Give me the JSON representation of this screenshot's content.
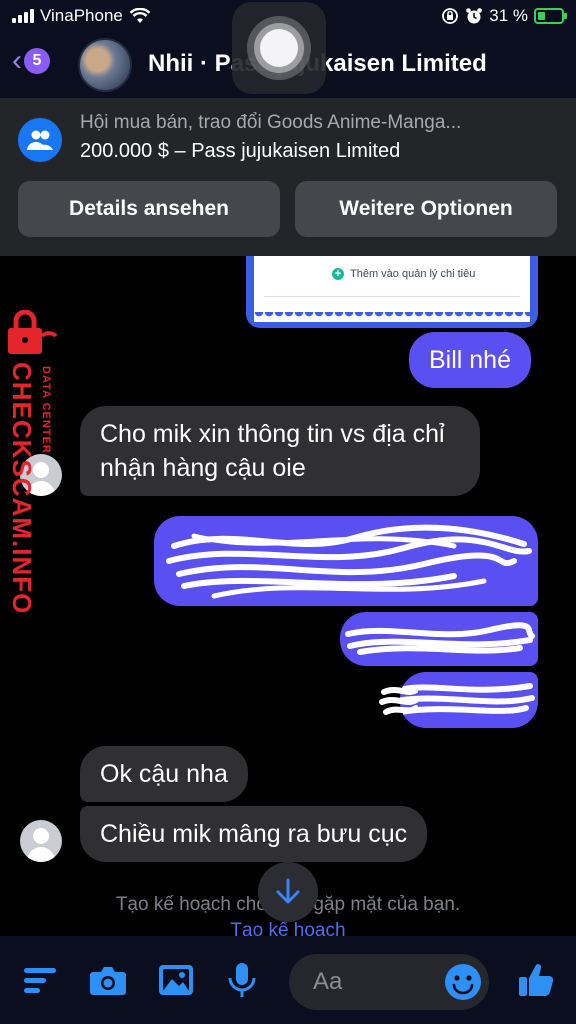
{
  "status_bar": {
    "carrier": "VinaPhone",
    "battery": "31 %",
    "battery_level": 0.31
  },
  "header": {
    "unread_count": "5",
    "title": "Nhii · Pass jujukaisen Limited"
  },
  "marketplace": {
    "group": "Hội mua bán, trao đổi Goods Anime-Manga...",
    "listing": "200.000 $ – Pass jujukaisen Limited",
    "details_button": "Details ansehen",
    "options_button": "Weitere Optionen"
  },
  "receipt": {
    "add_label": "Thêm vào quản lý chi tiêu"
  },
  "messages": [
    {
      "side": "out",
      "text": "Bill nhé"
    },
    {
      "side": "in",
      "text": "Cho mik xin thông tin vs địa chỉ nhận hàng cậu oie"
    },
    {
      "side": "in",
      "text": "Ok cậu nha"
    },
    {
      "side": "in",
      "text": "Chiều mik mâng ra bưu cục"
    }
  ],
  "watermark": {
    "brand": "CHECKSCAM.INFO",
    "sub": "DATA CENTER"
  },
  "plan": {
    "prompt": "Tạo kế hoạch cho buổi gặp mặt của bạn.",
    "link": "Tạo kế hoạch"
  },
  "composer": {
    "placeholder": "Aa"
  },
  "colors": {
    "accent": "#5a4ff1",
    "link": "#4d6ef0",
    "brand_blue": "#1877f2",
    "watermark_red": "#e5252c"
  },
  "icons": [
    "back-chevron-icon",
    "group-icon",
    "menu-icon",
    "camera-icon",
    "image-icon",
    "microphone-icon",
    "emoji-icon",
    "like-icon",
    "arrow-down-icon",
    "lock-icon",
    "wifi-icon",
    "alarm-icon",
    "orientation-lock-icon"
  ]
}
